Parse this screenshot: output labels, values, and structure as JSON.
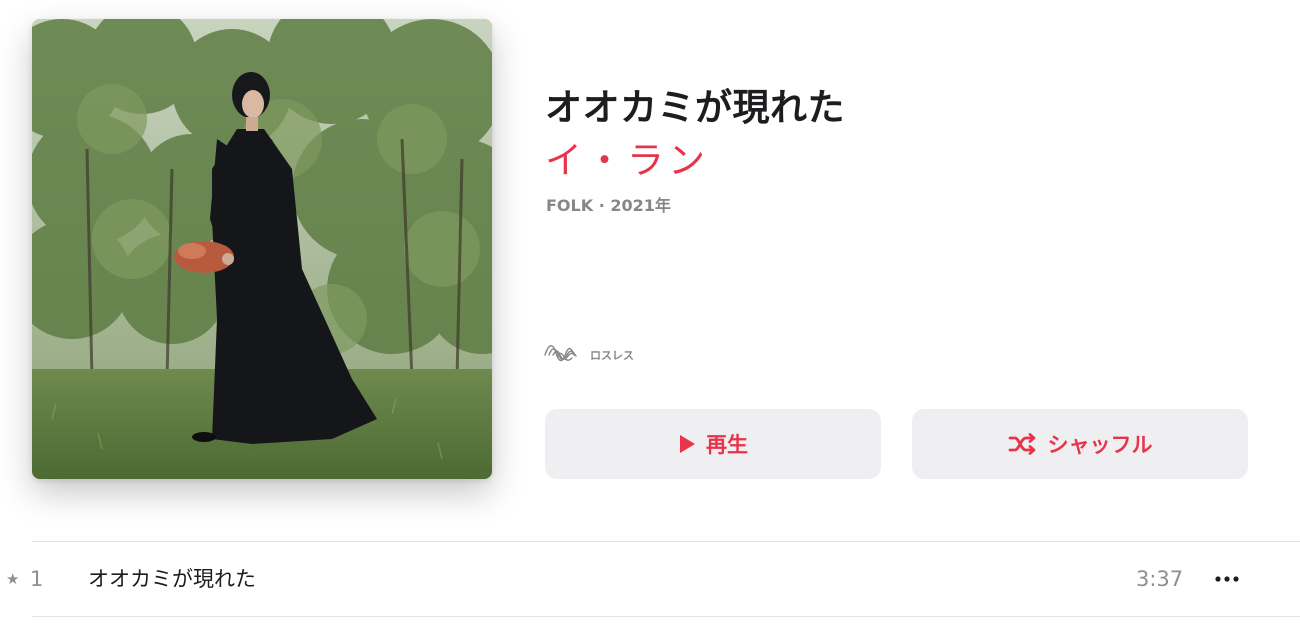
{
  "album": {
    "title": "オオカミが現れた",
    "artist": "イ・ラン",
    "meta": "FOLK · 2021年",
    "lossless_label": "ロスレス",
    "artwork_icon": "album-artwork"
  },
  "actions": {
    "play_label": "再生",
    "play_icon": "play-icon",
    "shuffle_label": "シャッフル",
    "shuffle_icon": "shuffle-icon"
  },
  "tracks": [
    {
      "favorite": "★",
      "number": "1",
      "title": "オオカミが現れた",
      "duration": "3:37",
      "more_icon": "ellipsis-icon"
    }
  ],
  "colors": {
    "accent": "#e8344a",
    "button_bg": "#efeff2",
    "secondary_text": "#86868b",
    "divider": "#e3e3e6"
  }
}
